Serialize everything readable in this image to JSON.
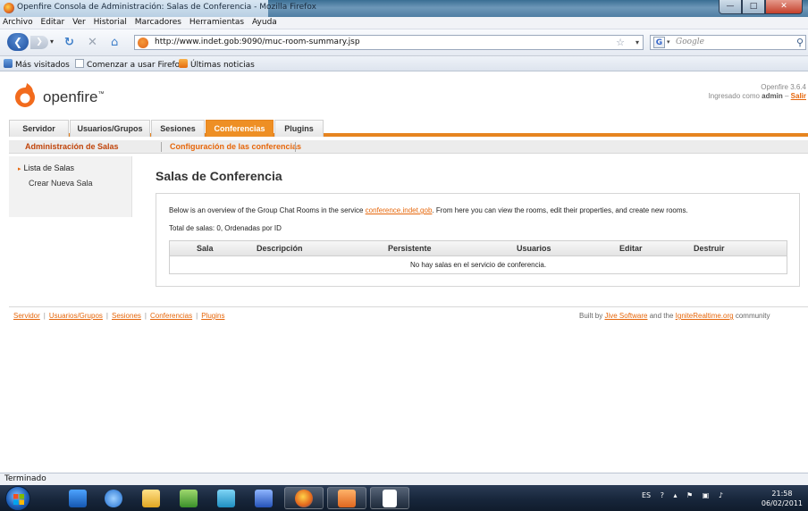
{
  "window": {
    "title": "Openfire Consola de Administración: Salas de Conferencia - Mozilla Firefox",
    "buttons": {
      "minimize": "—",
      "maximize": "□",
      "close": "✕"
    }
  },
  "menu": [
    "Archivo",
    "Editar",
    "Ver",
    "Historial",
    "Marcadores",
    "Herramientas",
    "Ayuda"
  ],
  "nav": {
    "url": "http://www.indet.gob:9090/muc-room-summary.jsp",
    "search_placeholder": "Google",
    "search_engine_letter": "G"
  },
  "bookmarks": [
    "Más visitados",
    "Comenzar a usar Firefox",
    "Últimas noticias"
  ],
  "header": {
    "logo_text": "openfire",
    "logo_tm": "™",
    "version": "Openfire 3.6.4",
    "logged_prefix": "Ingresado como",
    "user": "admin",
    "logout_sep": "–",
    "logout": "Salir"
  },
  "main_tabs": [
    "Servidor",
    "Usuarios/Grupos",
    "Sesiones",
    "Conferencias",
    "Plugins"
  ],
  "active_main_tab": "Conferencias",
  "sub_tabs": [
    "Administración de Salas",
    "Configuración de las conferencias"
  ],
  "sidebar": [
    "Lista de Salas",
    "Crear Nueva Sala"
  ],
  "content": {
    "heading": "Salas de Conferencia",
    "intro_before": "Below is an overview of the Group Chat Rooms in the service",
    "intro_link": "conference.indet.gob",
    "intro_after": ". From here you can view the rooms, edit their properties, and create new rooms.",
    "total": "Total de salas: 0, Ordenadas por ID",
    "columns": [
      "Sala",
      "Descripción",
      "Persistente",
      "Usuarios",
      "Editar",
      "Destruir"
    ],
    "empty": "No hay salas en el servicio de conferencia."
  },
  "footer": {
    "links": [
      "Servidor",
      "Usuarios/Grupos",
      "Sesiones",
      "Conferencias",
      "Plugins"
    ],
    "credits_prefix": "Built by",
    "credits_link1": "Jive Software",
    "credits_mid": "and the",
    "credits_link2": "IgniteRealtime.org",
    "credits_suffix": "community"
  },
  "status": "Terminado",
  "taskbar": {
    "lang": "ES",
    "time": "21:58",
    "date": "06/02/2011"
  },
  "colors": {
    "accent": "#ee8f24",
    "link": "#e6660a",
    "taskbar": "#17263b"
  }
}
